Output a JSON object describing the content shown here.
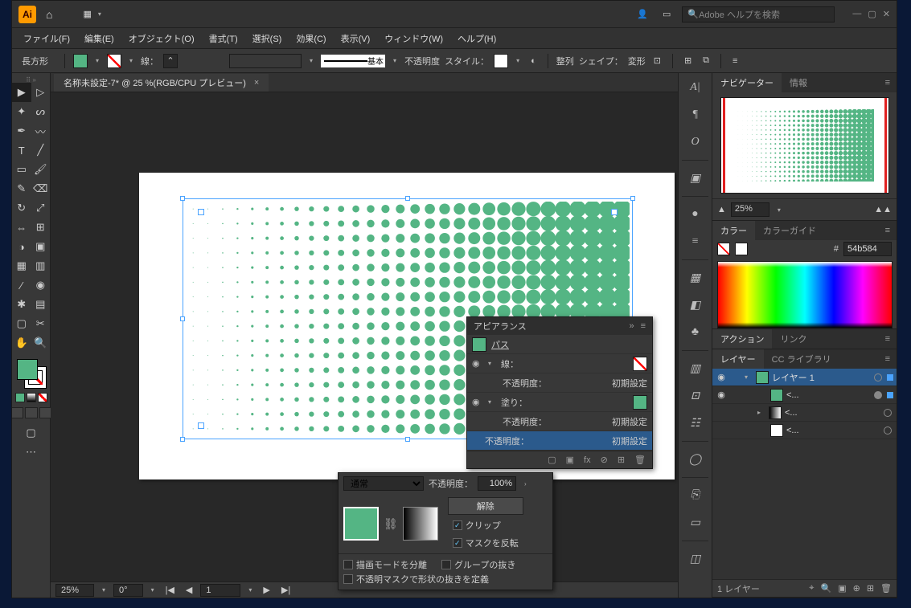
{
  "titlebar": {
    "logo_text": "Ai",
    "search_placeholder": "Adobe ヘルプを検索"
  },
  "menubar": {
    "file": "ファイル(F)",
    "edit": "編集(E)",
    "object": "オブジェクト(O)",
    "type": "書式(T)",
    "select": "選択(S)",
    "effect": "効果(C)",
    "view": "表示(V)",
    "window": "ウィンドウ(W)",
    "help": "ヘルプ(H)"
  },
  "controlbar": {
    "shape_label": "長方形",
    "stroke_label": "線：",
    "stroke_profile_label": "基本",
    "opacity_label": "不透明度",
    "style_label": "スタイル：",
    "align_label": "整列",
    "shape_props_label": "シェイプ：",
    "transform_label": "変形"
  },
  "document": {
    "tab_title": "名称未設定-7* @ 25 %(RGB/CPU プレビュー)"
  },
  "statusbar": {
    "zoom": "25%",
    "rotation": "0°",
    "artboard": "1"
  },
  "panels": {
    "navigator": {
      "tab": "ナビゲーター",
      "info_tab": "情報",
      "zoom": "25%"
    },
    "color": {
      "tab": "カラー",
      "guide_tab": "カラーガイド",
      "hash": "#",
      "hex": "54b584"
    },
    "actions": {
      "tab": "アクション",
      "links_tab": "リンク"
    },
    "layers": {
      "tab": "レイヤー",
      "cclib_tab": "CC ライブラリ",
      "rows": [
        {
          "name": "レイヤー 1"
        },
        {
          "name": "<..."
        },
        {
          "name": "<..."
        },
        {
          "name": "<..."
        }
      ],
      "footer_count": "1 レイヤー"
    }
  },
  "appearance": {
    "title": "アピアランス",
    "path_label": "パス",
    "stroke_label": "線：",
    "fill_label": "塗り：",
    "opacity_label": "不透明度：",
    "default_label": "初期設定"
  },
  "transparency": {
    "blend_mode": "通常",
    "opacity_label": "不透明度：",
    "opacity_value": "100%",
    "release_btn": "解除",
    "clip_label": "クリップ",
    "invert_label": "マスクを反転",
    "isolate_label": "描画モードを分離",
    "knockout_label": "グループの抜き",
    "define_label": "不透明マスクで形状の抜きを定義"
  }
}
